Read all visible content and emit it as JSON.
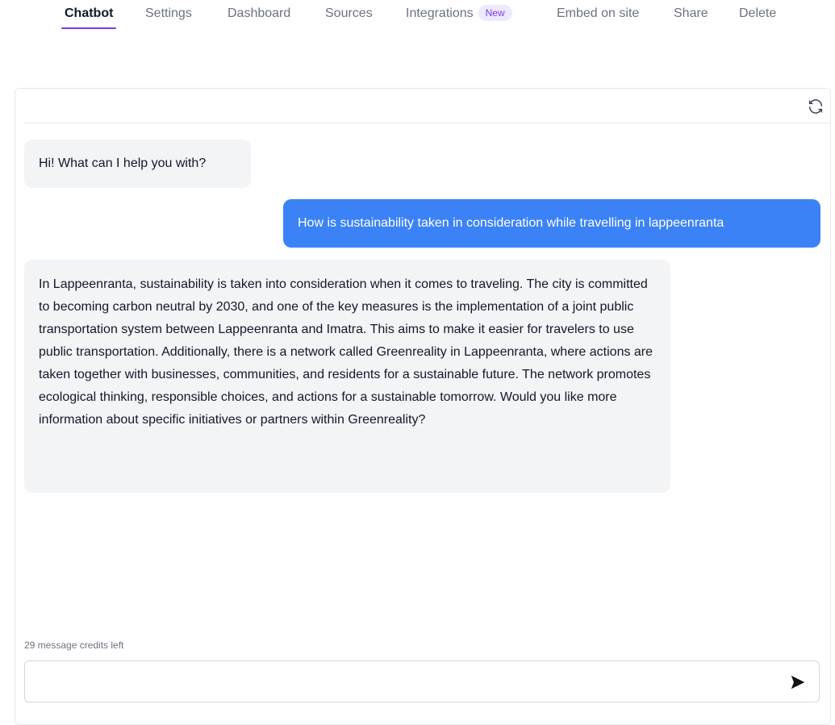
{
  "nav": {
    "tabs": [
      {
        "label": "Chatbot",
        "active": true
      },
      {
        "label": "Settings"
      },
      {
        "label": "Dashboard"
      },
      {
        "label": "Sources"
      },
      {
        "label": "Integrations",
        "badge": "New"
      },
      {
        "label": "Embed on site"
      },
      {
        "label": "Share"
      },
      {
        "label": "Delete"
      }
    ]
  },
  "chat": {
    "messages": [
      {
        "role": "bot",
        "text": "Hi! What can I help you with?"
      },
      {
        "role": "user",
        "text": "How is sustainability taken in consideration while travelling in lappeenranta"
      },
      {
        "role": "bot",
        "text": "In Lappeenranta, sustainability is taken into consideration when it comes to traveling. The city is committed to becoming carbon neutral by 2030, and one of the key measures is the implementation of a joint public transportation system between Lappeenranta and Imatra. This aims to make it easier for travelers to use public transportation. Additionally, there is a network called Greenreality in Lappeenranta, where actions are taken together with businesses, communities, and residents for a sustainable future. The network promotes ecological thinking, responsible choices, and actions for a sustainable tomorrow. Would you like more information about specific initiatives or partners within Greenreality?"
      }
    ],
    "credits_text": "29 message credits left",
    "input": {
      "value": "",
      "placeholder": ""
    },
    "icons": {
      "refresh": "refresh-icon",
      "send": "send-icon"
    }
  },
  "colors": {
    "accent": "#7c3aed",
    "user_bubble": "#3b82f6",
    "bot_bubble": "#f3f4f6",
    "border": "#e5e7eb"
  }
}
